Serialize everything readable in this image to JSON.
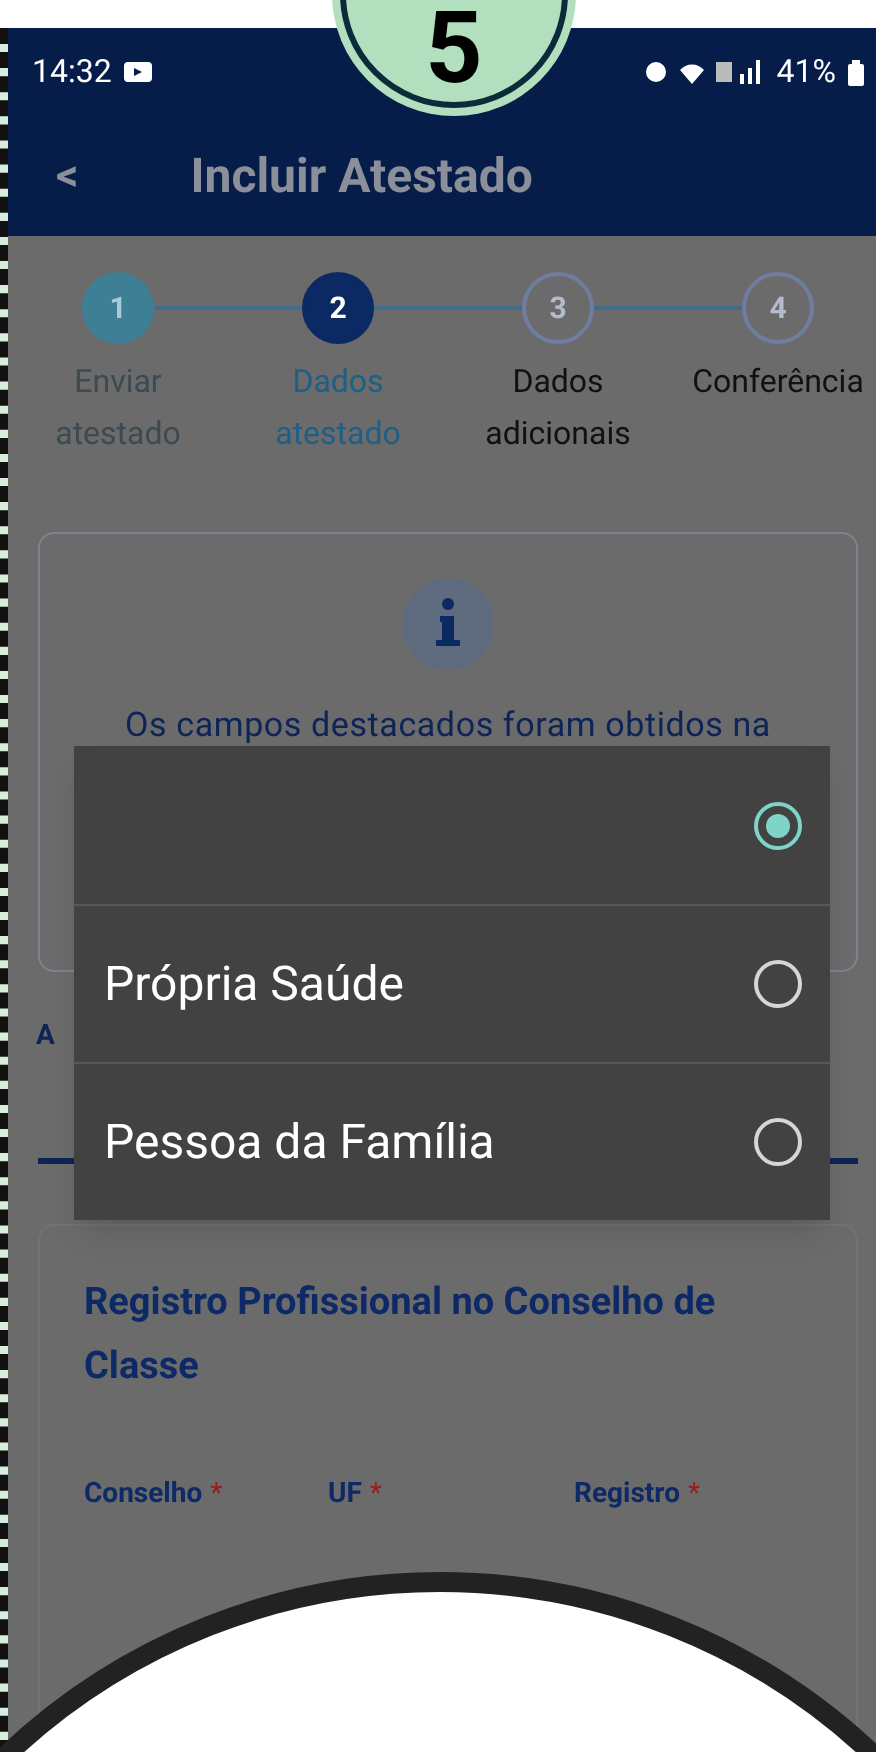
{
  "badge": {
    "number": "5"
  },
  "status_bar": {
    "time": "14:32",
    "battery": "41%"
  },
  "app_bar": {
    "back": "<",
    "title": "Incluir Atestado"
  },
  "stepper": [
    {
      "number": "1",
      "label": "Enviar atestado",
      "done": true,
      "selected": false
    },
    {
      "number": "2",
      "label": "Dados atestado",
      "done": false,
      "selected": true
    },
    {
      "number": "3",
      "label": "Dados adicionais",
      "done": false,
      "selected": false
    },
    {
      "number": "4",
      "label": "Conferência",
      "done": false,
      "selected": false
    }
  ],
  "info_card": {
    "text": "Os campos destacados foram obtidos na"
  },
  "covered_label": "A",
  "dialog": {
    "options": [
      {
        "selected": true
      },
      {
        "label": "Própria Saúde",
        "selected": false
      },
      {
        "label": "Pessoa da Família",
        "selected": false
      }
    ]
  },
  "registro_card": {
    "title": "Registro Profissional no Conselho de Classe",
    "fields": [
      {
        "label": "Conselho",
        "required_mark": "*"
      },
      {
        "label": "UF",
        "required_mark": "*"
      },
      {
        "label": "Registro",
        "required_mark": "*"
      }
    ]
  }
}
